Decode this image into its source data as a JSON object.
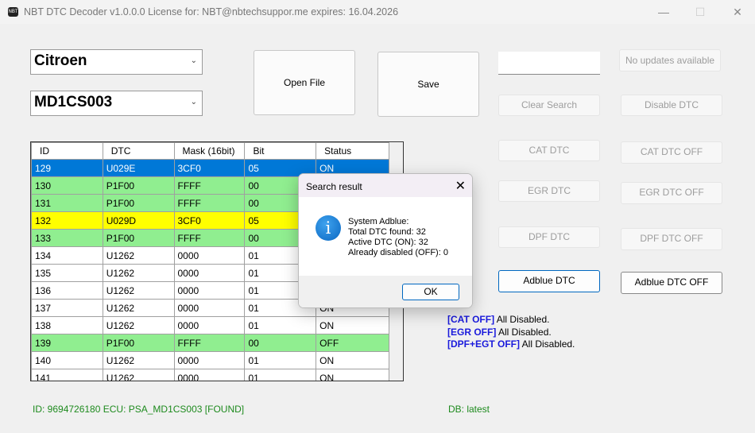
{
  "window": {
    "title": "NBT DTC Decoder v1.0.0.0  License for: NBT@nbtechsuppor.me expires: 16.04.2026",
    "icon_label": "NBT",
    "minimize": "—",
    "maximize": "☐",
    "close": "✕"
  },
  "selectors": {
    "make": "Citroen",
    "ecu": "MD1CS003"
  },
  "buttons": {
    "open_file": "Open File",
    "save": "Save",
    "no_updates": "No updates available",
    "clear_search": "Clear Search",
    "disable_dtc": "Disable DTC",
    "cat_dtc": "CAT DTC",
    "cat_dtc_off": "CAT  DTC OFF",
    "egr_dtc": "EGR DTC",
    "egr_dtc_off": "EGR DTC OFF",
    "dpf_dtc": "DPF DTC",
    "dpf_dtc_off": "DPF DTC OFF",
    "adblue_dtc": "Adblue DTC",
    "adblue_dtc_off": "Adblue DTC OFF"
  },
  "search": {
    "value": ""
  },
  "table": {
    "columns": [
      "ID",
      "DTC",
      "Mask (16bit)",
      "Bit",
      "Status"
    ],
    "rows": [
      {
        "id": "129",
        "dtc": "U029E",
        "mask": "3CF0",
        "bit": "05",
        "status": "ON",
        "style": "sel"
      },
      {
        "id": "130",
        "dtc": "P1F00",
        "mask": "FFFF",
        "bit": "00",
        "status": "",
        "style": "green"
      },
      {
        "id": "131",
        "dtc": "P1F00",
        "mask": "FFFF",
        "bit": "00",
        "status": "",
        "style": "green"
      },
      {
        "id": "132",
        "dtc": "U029D",
        "mask": "3CF0",
        "bit": "05",
        "status": "",
        "style": "yellow"
      },
      {
        "id": "133",
        "dtc": "P1F00",
        "mask": "FFFF",
        "bit": "00",
        "status": "",
        "style": "green"
      },
      {
        "id": "134",
        "dtc": "U1262",
        "mask": "0000",
        "bit": "01",
        "status": "",
        "style": "white"
      },
      {
        "id": "135",
        "dtc": "U1262",
        "mask": "0000",
        "bit": "01",
        "status": "",
        "style": "white"
      },
      {
        "id": "136",
        "dtc": "U1262",
        "mask": "0000",
        "bit": "01",
        "status": "",
        "style": "white"
      },
      {
        "id": "137",
        "dtc": "U1262",
        "mask": "0000",
        "bit": "01",
        "status": "ON",
        "style": "white"
      },
      {
        "id": "138",
        "dtc": "U1262",
        "mask": "0000",
        "bit": "01",
        "status": "ON",
        "style": "white"
      },
      {
        "id": "139",
        "dtc": "P1F00",
        "mask": "FFFF",
        "bit": "00",
        "status": "OFF",
        "style": "green"
      },
      {
        "id": "140",
        "dtc": "U1262",
        "mask": "0000",
        "bit": "01",
        "status": "ON",
        "style": "white"
      },
      {
        "id": "141",
        "dtc": "U1262",
        "mask": "0000",
        "bit": "01",
        "status": "ON",
        "style": "white"
      }
    ]
  },
  "log": [
    {
      "tag": "[CAT OFF]",
      "text": " All Disabled."
    },
    {
      "tag": "[EGR OFF]",
      "text": " All Disabled."
    },
    {
      "tag": "[DPF+EGT OFF]",
      "text": " All Disabled."
    }
  ],
  "status": {
    "ecu_info": "ID: 9694726180 ECU: PSA_MD1CS003 [FOUND]",
    "db": "DB: latest"
  },
  "dialog": {
    "title": "Search result",
    "close": "✕",
    "lines": [
      "System Adblue:",
      "Total DTC found: 32",
      "Active DTC (ON): 32",
      "Already disabled (OFF): 0"
    ],
    "ok": "OK",
    "icon": "i"
  }
}
